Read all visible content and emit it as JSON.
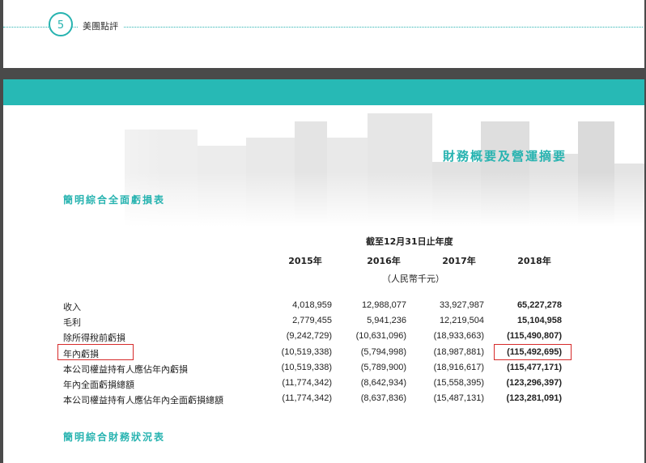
{
  "header": {
    "page_number": "5",
    "section_name": "美團點評"
  },
  "report": {
    "heading": "財務概要及營運摘要",
    "income_statement_title": "簡明綜合全面虧損表",
    "financial_position_title": "簡明綜合財務狀況表",
    "period_label": "截至12月31日止年度",
    "unit_label": "（人民幣千元）",
    "years": [
      "2015年",
      "2016年",
      "2017年",
      "2018年"
    ],
    "rows": [
      {
        "label": "收入",
        "values": [
          "4,018,959",
          "12,988,077",
          "33,927,987",
          "65,227,278"
        ]
      },
      {
        "label": "毛利",
        "values": [
          "2,779,455",
          "5,941,236",
          "12,219,504",
          "15,104,958"
        ]
      },
      {
        "label": "除所得稅前虧損",
        "values": [
          "(9,242,729)",
          "(10,631,096)",
          "(18,933,663)",
          "(115,490,807)"
        ]
      },
      {
        "label": "年內虧損",
        "values": [
          "(10,519,338)",
          "(5,794,998)",
          "(18,987,881)",
          "(115,492,695)"
        ],
        "highlighted": true
      },
      {
        "label": "本公司權益持有人應佔年內虧損",
        "values": [
          "(10,519,338)",
          "(5,789,900)",
          "(18,916,617)",
          "(115,477,171)"
        ]
      },
      {
        "label": "年內全面虧損總額",
        "values": [
          "(11,774,342)",
          "(8,642,934)",
          "(15,558,395)",
          "(123,296,397)"
        ]
      },
      {
        "label": "本公司權益持有人應佔年內全面虧損總額",
        "values": [
          "(11,774,342)",
          "(8,637,836)",
          "(15,487,131)",
          "(123,281,091)"
        ]
      }
    ]
  },
  "colors": {
    "accent": "#27b3b0",
    "band": "#27b9b5",
    "highlight_box": "#d62a2a",
    "viewer_background": "#4a4a4a"
  }
}
